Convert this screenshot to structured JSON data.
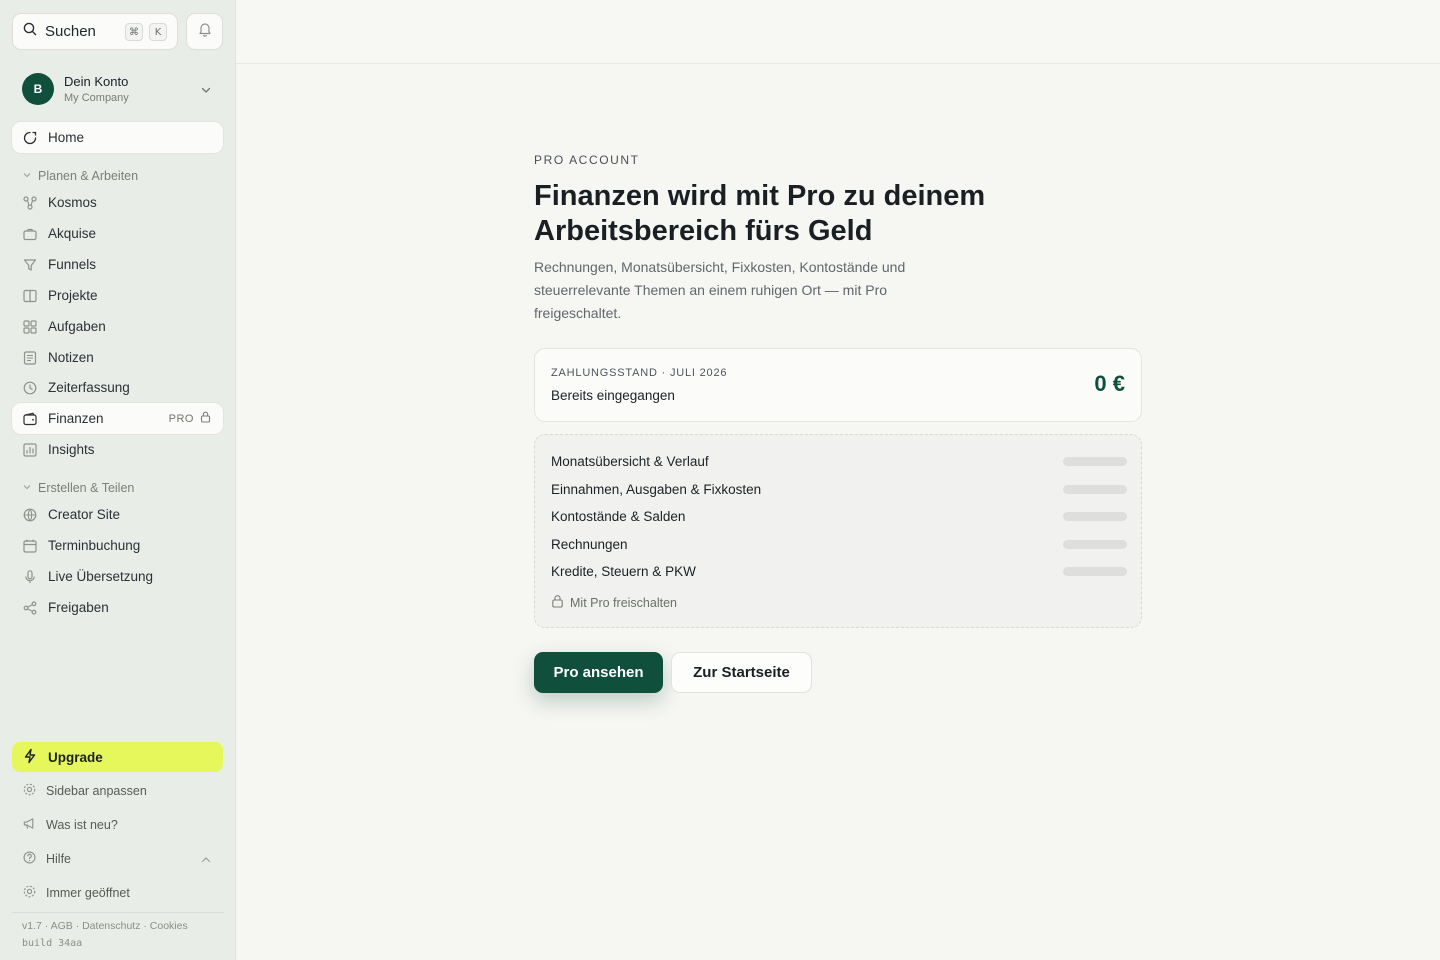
{
  "sidebar": {
    "search": {
      "label": "Suchen",
      "shortcut_mod": "⌘",
      "shortcut_key": "K"
    },
    "account": {
      "initial": "B",
      "name": "Dein Konto",
      "company": "My Company"
    },
    "home": {
      "label": "Home"
    },
    "section_planen": {
      "label": "Planen & Arbeiten"
    },
    "planen_items": [
      {
        "label": "Kosmos",
        "icon": "kosmos-icon"
      },
      {
        "label": "Akquise",
        "icon": "briefcase-icon"
      },
      {
        "label": "Funnels",
        "icon": "funnel-icon"
      },
      {
        "label": "Projekte",
        "icon": "columns-icon"
      },
      {
        "label": "Aufgaben",
        "icon": "grid-icon"
      },
      {
        "label": "Notizen",
        "icon": "note-icon"
      },
      {
        "label": "Zeiterfassung",
        "icon": "clock-icon"
      },
      {
        "label": "Finanzen",
        "icon": "wallet-icon",
        "badge": "PRO"
      },
      {
        "label": "Insights",
        "icon": "insights-icon"
      }
    ],
    "section_erstellen": {
      "label": "Erstellen & Teilen"
    },
    "erstellen_items": [
      {
        "label": "Creator Site",
        "icon": "globe-icon"
      },
      {
        "label": "Terminbuchung",
        "icon": "calendar-icon"
      },
      {
        "label": "Live Übersetzung",
        "icon": "microphone-icon"
      },
      {
        "label": "Freigaben",
        "icon": "share-icon"
      }
    ],
    "upgrade": {
      "label": "Upgrade"
    },
    "utility": {
      "customize": "Sidebar anpassen",
      "whats_new": "Was ist neu?",
      "help": "Hilfe",
      "always_open": "Immer geöffnet"
    },
    "footer": {
      "links": "v1.7 · AGB · Datenschutz · Cookies",
      "build": "build 34aa"
    }
  },
  "main": {
    "eyebrow": "PRO ACCOUNT",
    "headline": "Finanzen wird mit Pro zu deinem Arbeitsbereich fürs Geld",
    "subline": "Rechnungen, Monatsübersicht, Fixkosten, Kontostände und steuerrelevante Themen an einem ruhigen Ort — mit Pro freigeschaltet.",
    "status_card": {
      "eyebrow": "ZAHLUNGSSTAND · JULI 2026",
      "label": "Bereits eingegangen",
      "amount": "0 €"
    },
    "features": [
      "Monatsübersicht & Verlauf",
      "Einnahmen, Ausgaben & Fixkosten",
      "Kontostände & Salden",
      "Rechnungen",
      "Kredite, Steuern & PKW"
    ],
    "unlock_label": "Mit Pro freischalten",
    "primary_button": "Pro ansehen",
    "secondary_button": "Zur Startseite"
  },
  "colors": {
    "brand": "#0f4f3c",
    "upgrade": "#e5f75a",
    "sidebar_bg": "#e9ede8",
    "page_bg": "#f6f6f3"
  }
}
